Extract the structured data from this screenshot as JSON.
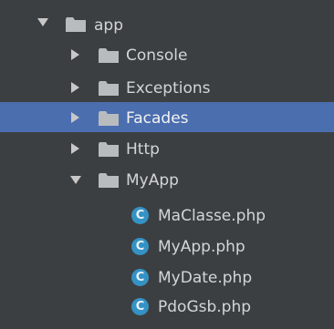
{
  "project_tree": {
    "root": {
      "label": "app",
      "expanded": true,
      "icon": "folder-icon"
    },
    "folders": [
      {
        "label": "Console",
        "expanded": false,
        "selected": false,
        "icon": "folder-icon"
      },
      {
        "label": "Exceptions",
        "expanded": false,
        "selected": false,
        "icon": "folder-icon"
      },
      {
        "label": "Facades",
        "expanded": false,
        "selected": true,
        "icon": "folder-icon"
      },
      {
        "label": "Http",
        "expanded": false,
        "selected": false,
        "icon": "folder-icon"
      },
      {
        "label": "MyApp",
        "expanded": true,
        "selected": false,
        "icon": "folder-icon"
      }
    ],
    "files": [
      {
        "label": "MaClasse.php",
        "icon": "php-class-icon",
        "icon_letter": "C"
      },
      {
        "label": "MyApp.php",
        "icon": "php-class-icon",
        "icon_letter": "C"
      },
      {
        "label": "MyDate.php",
        "icon": "php-class-icon",
        "icon_letter": "C"
      },
      {
        "label": "PdoGsb.php",
        "icon": "php-class-icon",
        "icon_letter": "C"
      }
    ]
  },
  "colors": {
    "background": "#3c3f41",
    "selection": "#4b6eaf",
    "text": "#d3d6d9",
    "class_icon": "#3592c4"
  }
}
